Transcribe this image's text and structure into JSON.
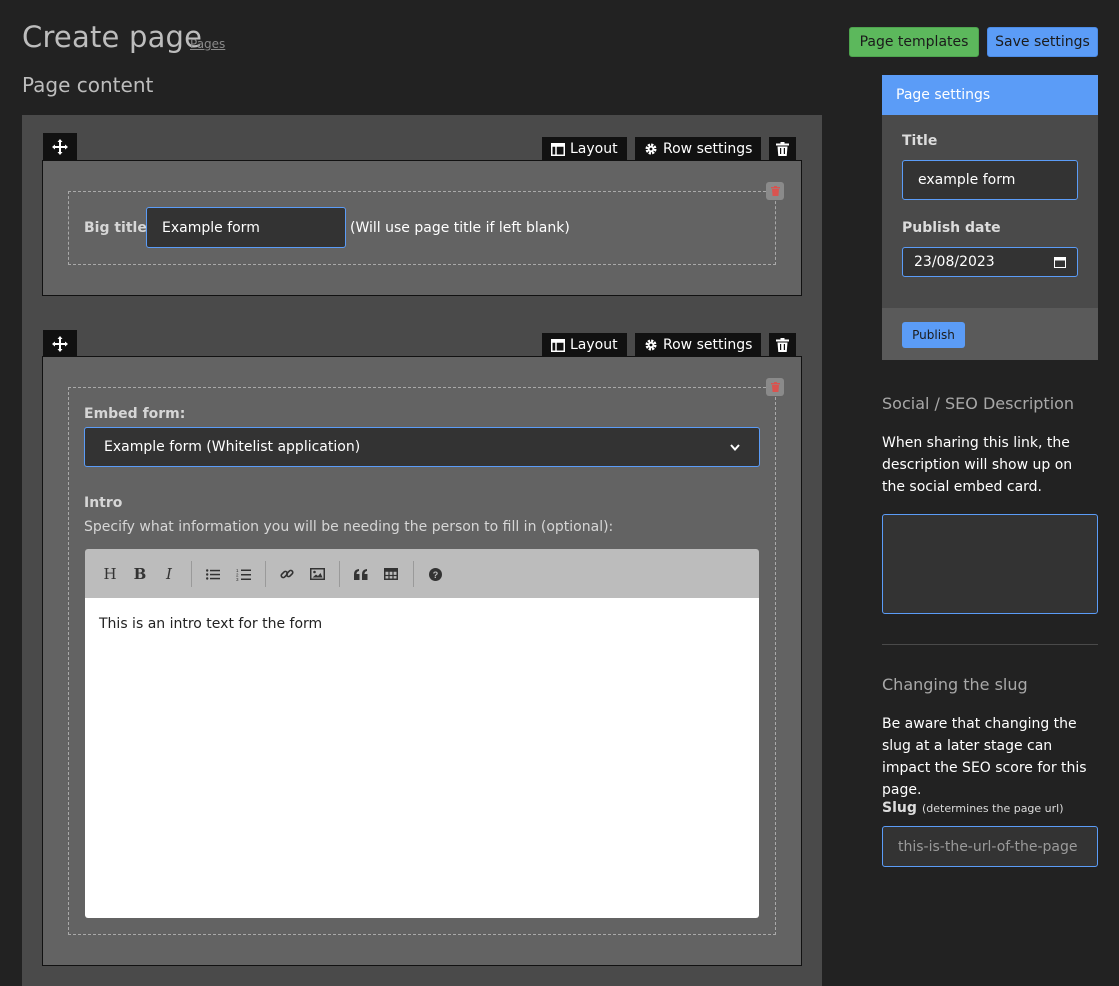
{
  "header": {
    "title": "Create page",
    "breadcrumb": "Pages",
    "templates_label": "Page templates",
    "save_label": "Save settings",
    "section_title": "Page content"
  },
  "toolbar": {
    "layout_label": "Layout",
    "row_settings_label": "Row settings"
  },
  "row1": {
    "big_title_label": "Big title:",
    "big_title_value": "Example form",
    "big_title_hint": "(Will use page title if left blank)"
  },
  "row2": {
    "embed_label": "Embed form:",
    "embed_selected": "Example form (Whitelist application)",
    "intro_label": "Intro",
    "intro_hint": "Specify what information you will be needing the person to fill in (optional):",
    "editor_content": "This is an intro text for the form",
    "editor_buttons": [
      "heading-icon",
      "bold-icon",
      "italic-icon",
      "bullet-list-icon",
      "numbered-list-icon",
      "link-icon",
      "image-icon",
      "quote-icon",
      "table-icon",
      "help-icon"
    ]
  },
  "sidebar": {
    "panel_title": "Page settings",
    "title_label": "Title",
    "title_value": "example form",
    "date_label": "Publish date",
    "date_value": "23/08/2023",
    "publish_label": "Publish",
    "seo_heading": "Social / SEO Description",
    "seo_text": "When sharing this link, the description will show up on the social embed card.",
    "slug_heading": "Changing the slug",
    "slug_text": "Be aware that changing the slug at a later stage can impact the SEO score for this page.",
    "slug_label": "Slug",
    "slug_sub": "(determines the page url)",
    "slug_placeholder": "this-is-the-url-of-the-page"
  },
  "colors": {
    "background": "#222222",
    "panel": "#4a4a4a",
    "accent_blue": "#5b9cf7",
    "accent_green": "#5cb85c"
  }
}
